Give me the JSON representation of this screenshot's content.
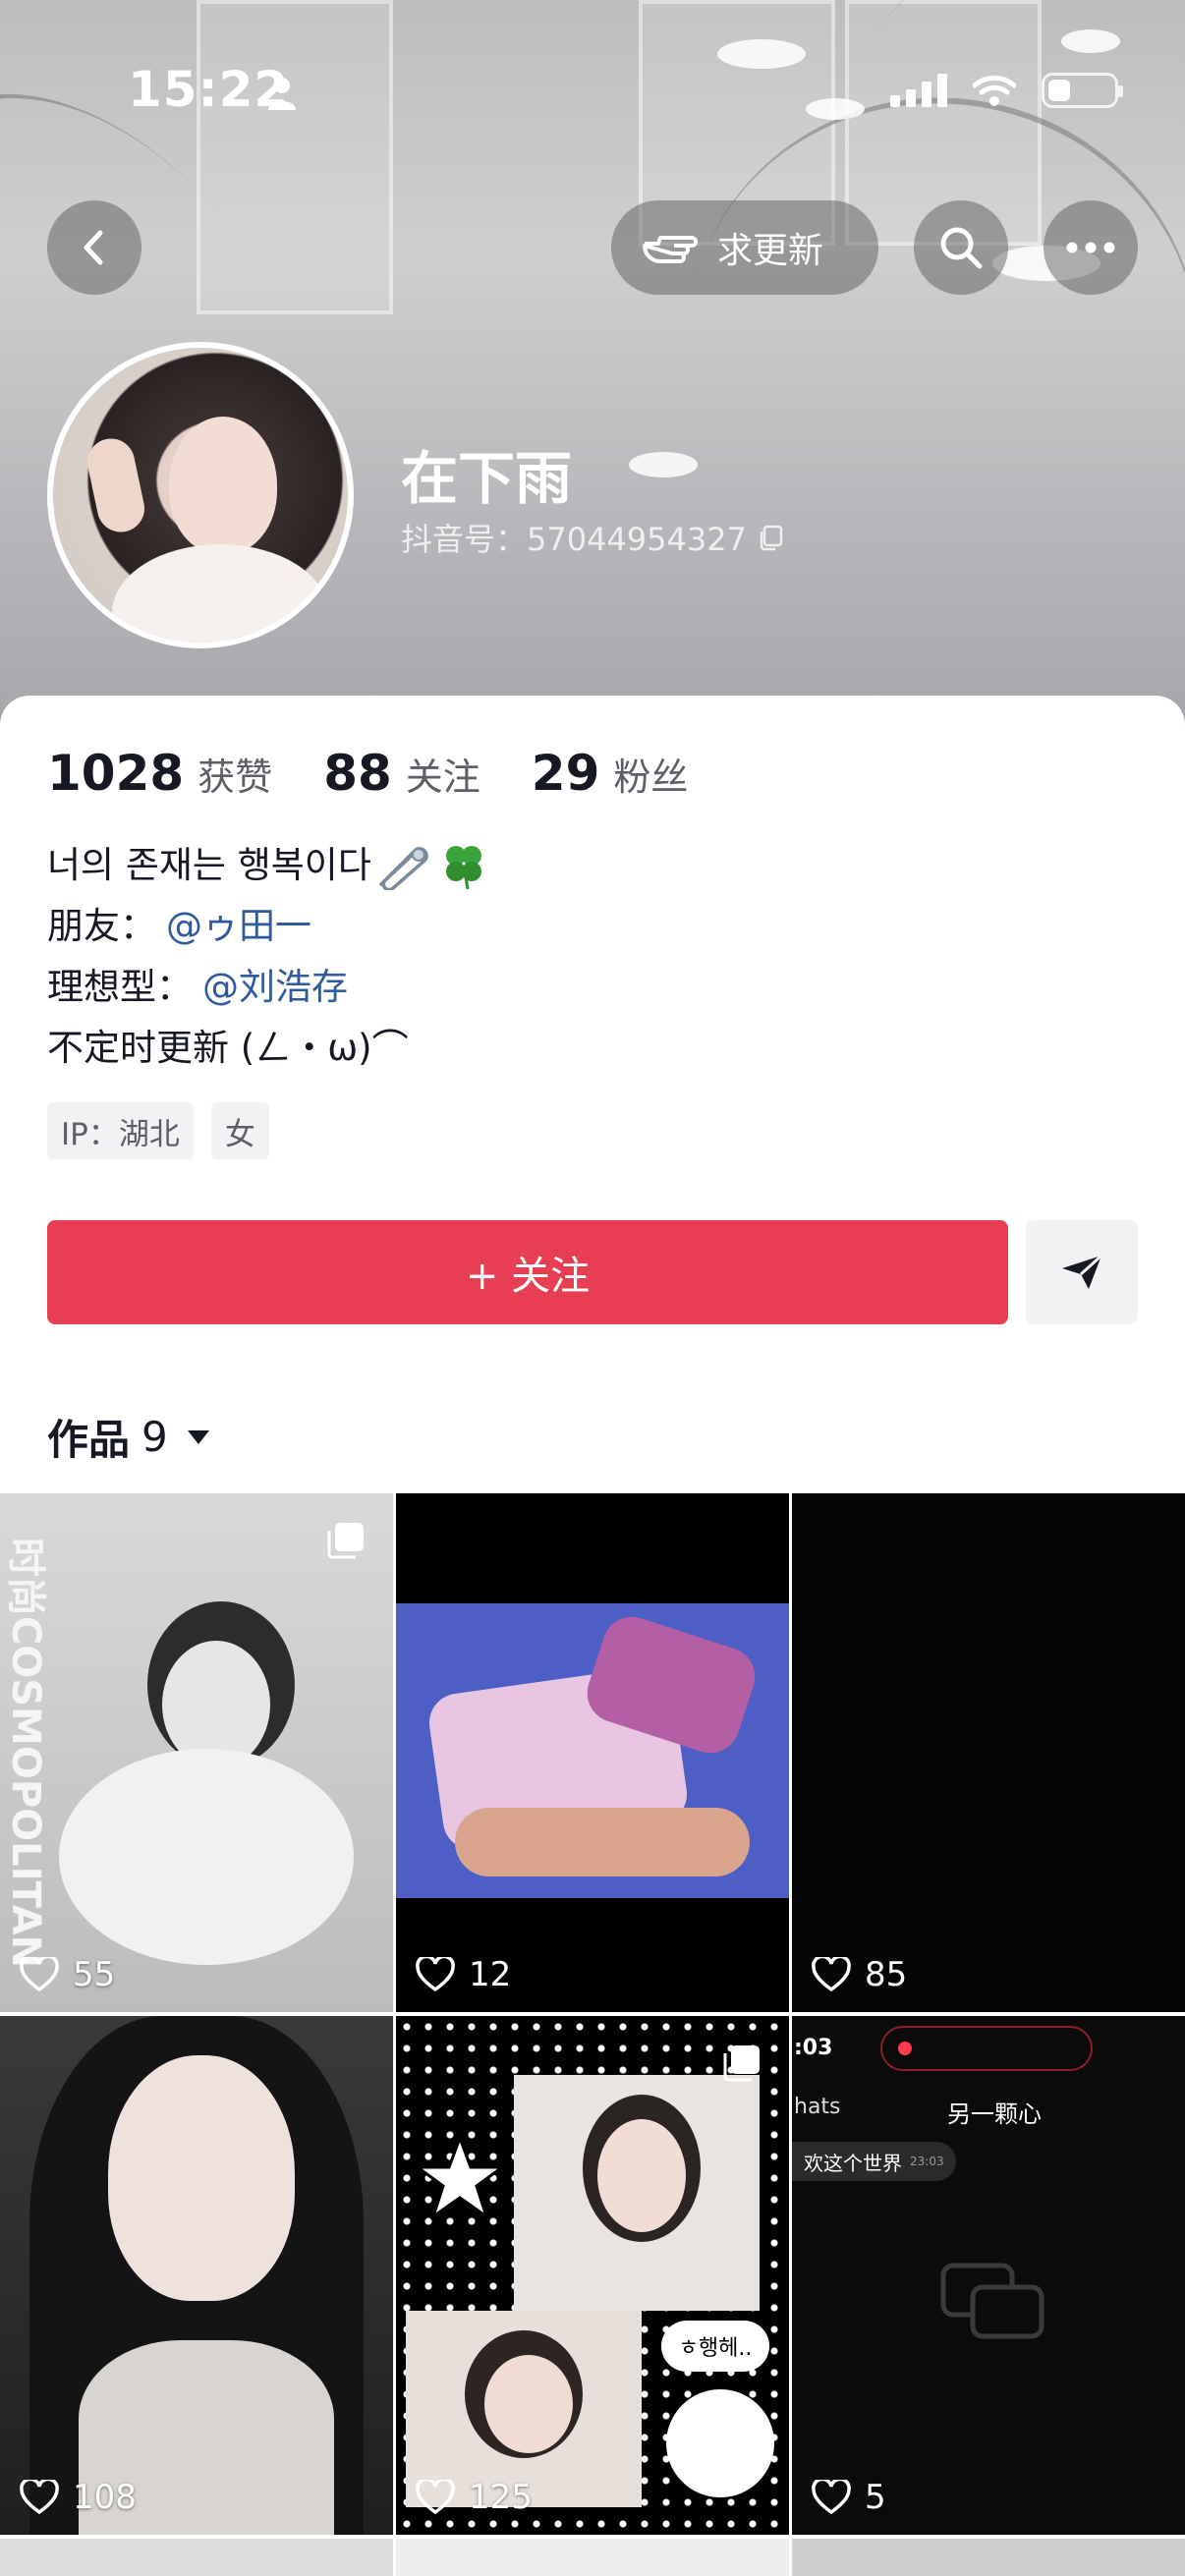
{
  "status_bar": {
    "time": "15:22"
  },
  "header": {
    "request_update_label": "求更新",
    "icons": [
      "back-icon",
      "hand-pointing-icon",
      "search-icon",
      "more-icon"
    ]
  },
  "profile": {
    "name": "在下雨",
    "douyin_id": "抖音号：57044954327"
  },
  "stats": [
    {
      "num": "1028",
      "label": "获赞"
    },
    {
      "num": "88",
      "label": "关注"
    },
    {
      "num": "29",
      "label": "粉丝"
    }
  ],
  "bio": {
    "line1": "너의 존재는 행복이다",
    "line2_prefix": "朋友：",
    "line2_mention": "@ゥ田一",
    "line3_prefix": "理想型：",
    "line3_mention": "@刘浩存",
    "line4": "不定时更新 (ㄥ・ω)⌒"
  },
  "tags": [
    "IP：湖北",
    "女"
  ],
  "actions": {
    "follow_label": "+ 关注"
  },
  "works": {
    "label": "作品",
    "count": "9"
  },
  "grid": [
    {
      "likes": "55",
      "multi": true
    },
    {
      "likes": "12",
      "multi": false
    },
    {
      "likes": "85",
      "multi": false
    },
    {
      "likes": "108",
      "multi": false
    },
    {
      "likes": "125",
      "multi": true
    },
    {
      "likes": "5",
      "multi": false
    }
  ],
  "grid_texts": {
    "cell1_watermark": "时尚COSMOPOLITAN",
    "cell5_bubble": "ㅎ행헤..",
    "cell6_time": ":03",
    "cell6_title": "另一颗心",
    "cell6_left": "hats",
    "cell6_msg": "欢这个世界",
    "cell6_msg_time": "23:03"
  },
  "colors": {
    "follow": "#e83e54",
    "mention": "#2f5a9b"
  }
}
